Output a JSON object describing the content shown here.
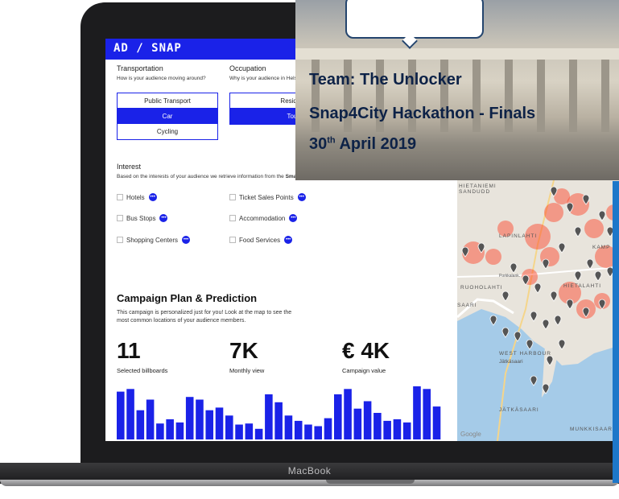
{
  "app": {
    "logo_text": "AD / SNAP",
    "accent_color": "#1a22e8"
  },
  "device": {
    "brand": "MacBook"
  },
  "overlay": {
    "team_line": "Team: The Unlocker",
    "event_line": "Snap4City Hackathon - Finals",
    "date_day": "30",
    "date_suffix": "th",
    "date_rest": "April 2019"
  },
  "transportation": {
    "title": "Transportation",
    "subtitle": "How is your audience moving around?",
    "options": [
      "Public Transport",
      "Car",
      "Cycling"
    ],
    "selected": "Car"
  },
  "occupation": {
    "title": "Occupation",
    "subtitle": "Why is your audience in Hels",
    "options": [
      "Resident",
      "Tourist"
    ],
    "selected": "Tourist"
  },
  "interest": {
    "title": "Interest",
    "subtitle_start": "Based on the interests of your audience we retrieve information from the ",
    "subtitle_bold": "Sma",
    "items": [
      {
        "label": "Hotels",
        "checked": false
      },
      {
        "label": "Ticket Sales Points",
        "checked": false
      },
      {
        "label": "Bus Stops",
        "checked": false
      },
      {
        "label": "Accommodation",
        "checked": false
      },
      {
        "label": "Shopping Centers",
        "checked": false
      },
      {
        "label": "Food Services",
        "checked": false
      }
    ],
    "more_icon": "more-dots-icon"
  },
  "campaign": {
    "title": "Campaign Plan & Prediction",
    "description": "This campaign is personalized just for you! Look at the map to see the most common locations of your audience members.",
    "stats": [
      {
        "value": "11",
        "label": "Selected billboards"
      },
      {
        "value": "7K",
        "label": "Monthly view"
      },
      {
        "value": "€ 4K",
        "label": "Campaign value"
      }
    ],
    "bar_values": [
      90,
      95,
      55,
      75,
      30,
      38,
      32,
      80,
      75,
      55,
      60,
      45,
      28,
      30,
      20,
      85,
      70,
      45,
      35,
      28,
      25,
      40,
      85,
      95,
      58,
      72,
      50,
      35,
      38,
      32,
      100,
      95,
      62
    ]
  },
  "map": {
    "labels": [
      "HIETANIEMI SANDUDD",
      "LAPINLAHTI",
      "RUOHOLAHTI",
      "SAARI",
      "WEST HARBOUR",
      "Jätkäsaari",
      "JÄTKÄSAARI",
      "HIETALAHTI",
      "MUNKKISAARI",
      "KAMP",
      "Porkkalank."
    ],
    "attribution": "Google",
    "heat_color": "#ff3b1f",
    "pin_color": "#555555"
  }
}
